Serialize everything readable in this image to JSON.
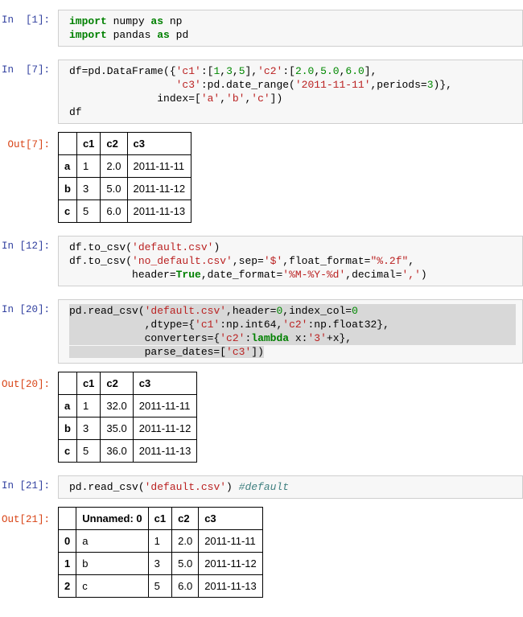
{
  "colors": {
    "in_prompt": "#303f9f",
    "out_prompt": "#d84315",
    "keyword": "#008000",
    "number": "#008800",
    "string": "#ba2121",
    "comment": "#408080",
    "selection": "#d8d8d8",
    "cell_bg": "#f7f7f7",
    "cell_border": "#cfcfcf",
    "table_border": "#000000"
  },
  "notebook": {
    "cells": [
      {
        "name": "cell-import",
        "prompt": "In  [1]:",
        "lines": [
          {
            "tokens": [
              {
                "t": "import",
                "c": "kw"
              },
              {
                "t": " numpy ",
                "c": ""
              },
              {
                "t": "as",
                "c": "kw"
              },
              {
                "t": " np",
                "c": ""
              }
            ]
          },
          {
            "tokens": [
              {
                "t": "import",
                "c": "kw"
              },
              {
                "t": " pandas ",
                "c": ""
              },
              {
                "t": "as",
                "c": "kw"
              },
              {
                "t": " pd",
                "c": ""
              }
            ]
          }
        ]
      },
      {
        "name": "cell-dataframe",
        "prompt": "In  [7]:",
        "lines": [
          {
            "tokens": [
              {
                "t": "df=pd.DataFrame({",
                "c": ""
              },
              {
                "t": "'c1'",
                "c": "str"
              },
              {
                "t": ":[",
                "c": ""
              },
              {
                "t": "1",
                "c": "num"
              },
              {
                "t": ",",
                "c": ""
              },
              {
                "t": "3",
                "c": "num"
              },
              {
                "t": ",",
                "c": ""
              },
              {
                "t": "5",
                "c": "num"
              },
              {
                "t": "],",
                "c": ""
              },
              {
                "t": "'c2'",
                "c": "str"
              },
              {
                "t": ":[",
                "c": ""
              },
              {
                "t": "2.0",
                "c": "num"
              },
              {
                "t": ",",
                "c": ""
              },
              {
                "t": "5.0",
                "c": "num"
              },
              {
                "t": ",",
                "c": ""
              },
              {
                "t": "6.0",
                "c": "num"
              },
              {
                "t": "],",
                "c": ""
              }
            ]
          },
          {
            "tokens": [
              {
                "t": "                 ",
                "c": ""
              },
              {
                "t": "'c3'",
                "c": "str"
              },
              {
                "t": ":pd.date_range(",
                "c": ""
              },
              {
                "t": "'2011-11-11'",
                "c": "str"
              },
              {
                "t": ",periods=",
                "c": ""
              },
              {
                "t": "3",
                "c": "num"
              },
              {
                "t": ")},",
                "c": ""
              }
            ]
          },
          {
            "tokens": [
              {
                "t": "              index=[",
                "c": ""
              },
              {
                "t": "'a'",
                "c": "str"
              },
              {
                "t": ",",
                "c": ""
              },
              {
                "t": "'b'",
                "c": "str"
              },
              {
                "t": ",",
                "c": ""
              },
              {
                "t": "'c'",
                "c": "str"
              },
              {
                "t": "])",
                "c": ""
              }
            ]
          },
          {
            "tokens": [
              {
                "t": "df",
                "c": ""
              }
            ]
          }
        ],
        "output": {
          "prompt": "Out[7]:",
          "table": {
            "headers": [
              "",
              "c1",
              "c2",
              "c3"
            ],
            "rows": [
              [
                "a",
                "1",
                "2.0",
                "2011-11-11"
              ],
              [
                "b",
                "3",
                "5.0",
                "2011-11-12"
              ],
              [
                "c",
                "5",
                "6.0",
                "2011-11-13"
              ]
            ]
          }
        }
      },
      {
        "name": "cell-to-csv",
        "prompt": "In [12]:",
        "lines": [
          {
            "tokens": [
              {
                "t": "df.to_csv(",
                "c": ""
              },
              {
                "t": "'default.csv'",
                "c": "str"
              },
              {
                "t": ")",
                "c": ""
              }
            ]
          },
          {
            "tokens": [
              {
                "t": "df.to_csv(",
                "c": ""
              },
              {
                "t": "'no_default.csv'",
                "c": "str"
              },
              {
                "t": ",sep=",
                "c": ""
              },
              {
                "t": "'$'",
                "c": "str"
              },
              {
                "t": ",float_format=",
                "c": ""
              },
              {
                "t": "\"%.2f\"",
                "c": "str"
              },
              {
                "t": ",",
                "c": ""
              }
            ]
          },
          {
            "tokens": [
              {
                "t": "          header=",
                "c": ""
              },
              {
                "t": "True",
                "c": "kw"
              },
              {
                "t": ",date_format=",
                "c": ""
              },
              {
                "t": "'%M-%Y-%d'",
                "c": "str"
              },
              {
                "t": ",decimal=",
                "c": ""
              },
              {
                "t": "','",
                "c": "str"
              },
              {
                "t": ")",
                "c": ""
              }
            ]
          }
        ]
      },
      {
        "name": "cell-read-csv-options",
        "prompt": "In [20]:",
        "lines": [
          {
            "sel": "block",
            "tokens": [
              {
                "t": "pd.read_csv(",
                "c": ""
              },
              {
                "t": "'default.csv'",
                "c": "str"
              },
              {
                "t": ",header=",
                "c": ""
              },
              {
                "t": "0",
                "c": "num"
              },
              {
                "t": ",index_col=",
                "c": ""
              },
              {
                "t": "0",
                "c": "num"
              }
            ]
          },
          {
            "sel": "block",
            "tokens": [
              {
                "t": "            ,dtype={",
                "c": ""
              },
              {
                "t": "'c1'",
                "c": "str"
              },
              {
                "t": ":np.int64,",
                "c": ""
              },
              {
                "t": "'c2'",
                "c": "str"
              },
              {
                "t": ":np.float32},",
                "c": ""
              }
            ]
          },
          {
            "sel": "block",
            "tokens": [
              {
                "t": "            converters={",
                "c": ""
              },
              {
                "t": "'c2'",
                "c": "str"
              },
              {
                "t": ":",
                "c": ""
              },
              {
                "t": "lambda",
                "c": "kw"
              },
              {
                "t": " x:",
                "c": ""
              },
              {
                "t": "'3'",
                "c": "str"
              },
              {
                "t": "+x},",
                "c": ""
              }
            ]
          },
          {
            "sel": "inline",
            "tokens": [
              {
                "t": "            parse_dates=[",
                "c": ""
              },
              {
                "t": "'c3'",
                "c": "str"
              },
              {
                "t": "])",
                "c": ""
              }
            ]
          }
        ],
        "output": {
          "prompt": "Out[20]:",
          "table": {
            "headers": [
              "",
              "c1",
              "c2",
              "c3"
            ],
            "rows": [
              [
                "a",
                "1",
                "32.0",
                "2011-11-11"
              ],
              [
                "b",
                "3",
                "35.0",
                "2011-11-12"
              ],
              [
                "c",
                "5",
                "36.0",
                "2011-11-13"
              ]
            ]
          }
        }
      },
      {
        "name": "cell-read-csv-default",
        "prompt": "In [21]:",
        "lines": [
          {
            "tokens": [
              {
                "t": "pd.read_csv(",
                "c": ""
              },
              {
                "t": "'default.csv'",
                "c": "str"
              },
              {
                "t": ") ",
                "c": ""
              },
              {
                "t": "#default",
                "c": "com"
              }
            ]
          }
        ],
        "output": {
          "prompt": "Out[21]:",
          "table": {
            "headers": [
              "",
              "Unnamed: 0",
              "c1",
              "c2",
              "c3"
            ],
            "rows": [
              [
                "0",
                "a",
                "1",
                "2.0",
                "2011-11-11"
              ],
              [
                "1",
                "b",
                "3",
                "5.0",
                "2011-11-12"
              ],
              [
                "2",
                "c",
                "5",
                "6.0",
                "2011-11-13"
              ]
            ]
          }
        }
      }
    ]
  }
}
